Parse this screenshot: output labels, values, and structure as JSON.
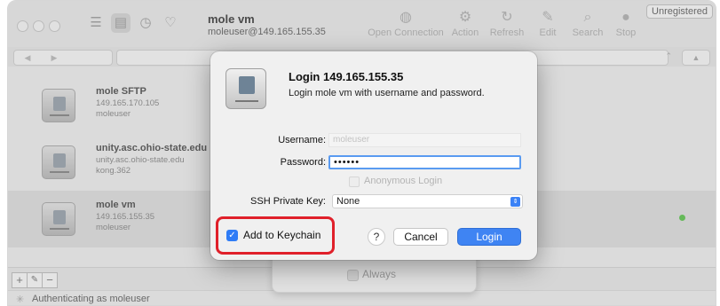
{
  "window": {
    "title": "mole vm",
    "subtitle": "moleuser@149.165.155.35",
    "unregistered": "Unregistered"
  },
  "toolbar": {
    "actions": [
      {
        "label": "Open Connection",
        "icon": "globe-icon"
      },
      {
        "label": "Action",
        "icon": "gear-icon"
      },
      {
        "label": "Refresh",
        "icon": "refresh-icon"
      },
      {
        "label": "Edit",
        "icon": "pencil-icon"
      },
      {
        "label": "Search",
        "icon": "search-icon"
      },
      {
        "label": "Stop",
        "icon": "stop-icon"
      }
    ]
  },
  "bookmarks": [
    {
      "name": "mole SFTP",
      "line1": "149.165.170.105",
      "line2": "moleuser",
      "selected": false
    },
    {
      "name": "unity.asc.ohio-state.edu",
      "line1": "unity.asc.ohio-state.edu",
      "line2": "kong.362",
      "selected": false
    },
    {
      "name": "mole vm",
      "line1": "149.165.155.35",
      "line2": "moleuser",
      "selected": true
    }
  ],
  "status": {
    "text": "Authenticating as moleuser",
    "connected_color": "#62c454"
  },
  "background_sheet": {
    "always_label": "Always"
  },
  "dialog": {
    "title": "Login 149.165.155.35",
    "message": "Login mole vm with username and password.",
    "username_label": "Username:",
    "username_placeholder": "moleuser",
    "password_label": "Password:",
    "password_value": "••••••",
    "anonymous_label": "Anonymous Login",
    "ssh_key_label": "SSH Private Key:",
    "ssh_key_value": "None",
    "keychain_label": "Add to Keychain",
    "keychain_checked": true,
    "help_label": "?",
    "cancel_label": "Cancel",
    "login_label": "Login",
    "highlight_color": "#e0202a",
    "accent_color": "#3f84f3"
  }
}
